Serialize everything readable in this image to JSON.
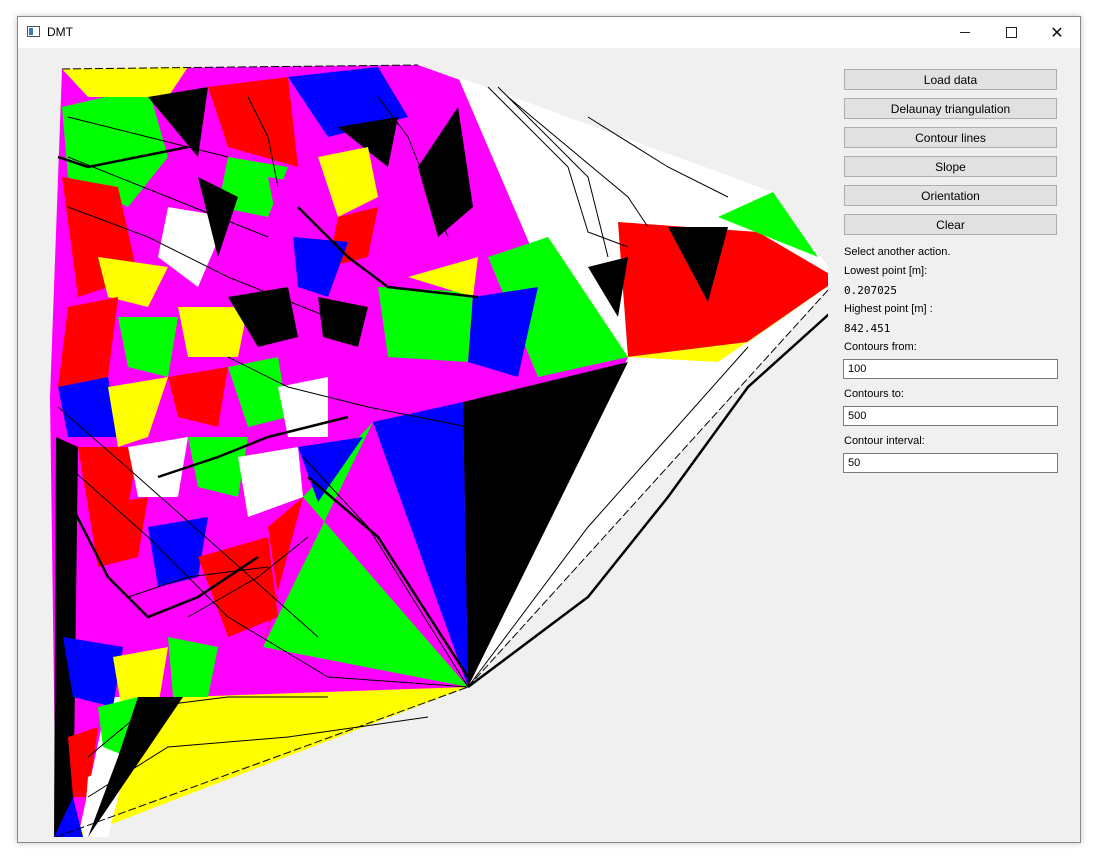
{
  "window": {
    "title": "DMT",
    "controls": {
      "minimize": "minimize-icon",
      "maximize": "maximize-icon",
      "close": "close-icon"
    }
  },
  "colors": {
    "magenta": "#ff00ff",
    "green": "#00ff00",
    "yellow": "#ffff00",
    "red": "#ff0000",
    "blue": "#0000ff",
    "black": "#000000",
    "white": "#ffffff"
  },
  "panel": {
    "buttons": {
      "load": "Load data",
      "delaunay": "Delaunay triangulation",
      "contours": "Contour lines",
      "slope": "Slope",
      "orientation": "Orientation",
      "clear": "Clear"
    },
    "status": "Select another action.",
    "lowest_label": "Lowest point [m]:",
    "lowest_value": "0.207025",
    "highest_label": "Highest point [m] :",
    "highest_value": "842.451",
    "contours_from_label": "Contours from:",
    "contours_from": "100",
    "contours_to_label": "Contours to:",
    "contours_to": "500",
    "interval_label": "Contour interval:",
    "interval": "50"
  }
}
